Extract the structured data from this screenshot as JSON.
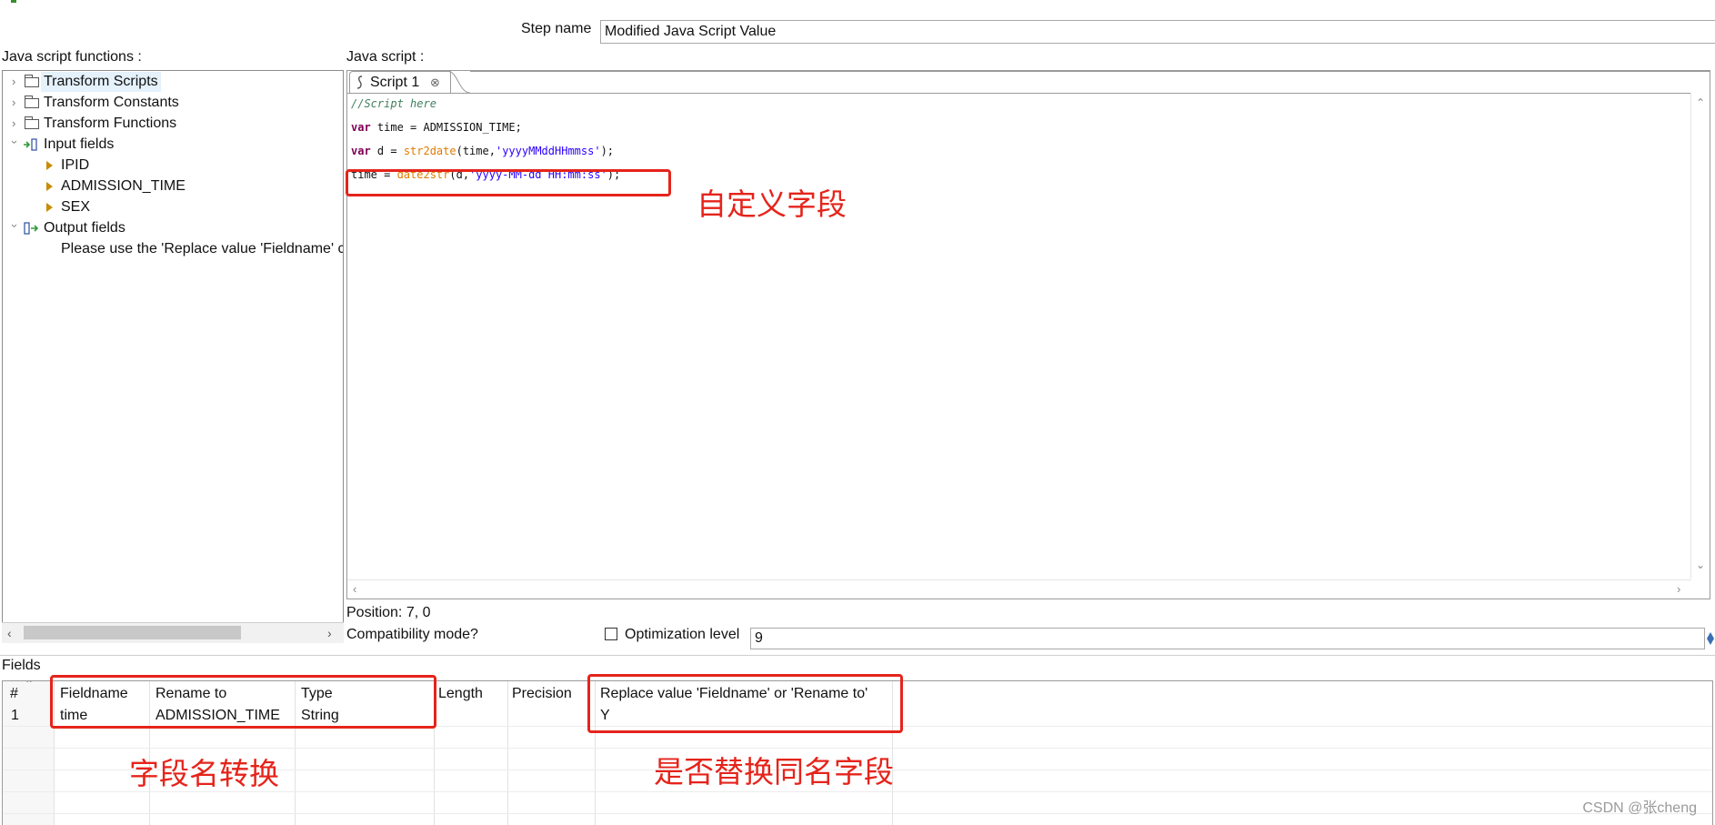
{
  "dialog": {
    "step_name_label": "Step name",
    "step_name_value": "Modified Java Script Value"
  },
  "functions_panel": {
    "label": "Java script functions :",
    "tree": {
      "transform_scripts": "Transform Scripts",
      "transform_constants": "Transform Constants",
      "transform_functions": "Transform Functions",
      "input_fields": "Input fields",
      "input_items": [
        "IPID",
        "ADMISSION_TIME",
        "SEX"
      ],
      "output_fields": "Output fields",
      "output_hint": "Please use the 'Replace value 'Fieldname' c"
    }
  },
  "script_panel": {
    "label": "Java script :",
    "tab_label": "Script 1",
    "code": {
      "comment": "//Script here",
      "line2_kw": "var",
      "line2_rest": " time = ADMISSION_TIME;",
      "line3_kw": "var",
      "line3_a": " d = ",
      "line3_fn": "str2date",
      "line3_b": "(time,",
      "line3_str": "'yyyyMMddHHmmss'",
      "line3_c": ");",
      "line4_a": "time = ",
      "line4_fn": "date2str",
      "line4_b": "(d,",
      "line4_str": "'yyyy-MM-dd HH:mm:ss'",
      "line4_c": ");"
    }
  },
  "status": {
    "position": "Position: 7, 0",
    "compat_label": "Compatibility mode?",
    "optimization_label": "Optimization level",
    "optimization_value": "9"
  },
  "fields_table": {
    "label": "Fields",
    "headers": [
      "#",
      "Fieldname",
      "Rename to",
      "Type",
      "Length",
      "Precision",
      "Replace value 'Fieldname' or 'Rename to'"
    ],
    "rows": [
      {
        "no": "1",
        "fieldname": "time",
        "rename_to": "ADMISSION_TIME",
        "type": "String",
        "length": "",
        "precision": "",
        "replace": "Y"
      }
    ]
  },
  "annotations": {
    "custom_field": "自定义字段",
    "field_rename": "字段名转换",
    "replace_same_name": "是否替换同名字段"
  },
  "watermark": "CSDN @张cheng",
  "colors": {
    "annotation_red": "#e5241b",
    "keyword": "#7f0055",
    "function": "#e07b00",
    "string": "#2a00ff",
    "comment": "#3f7f5f"
  }
}
